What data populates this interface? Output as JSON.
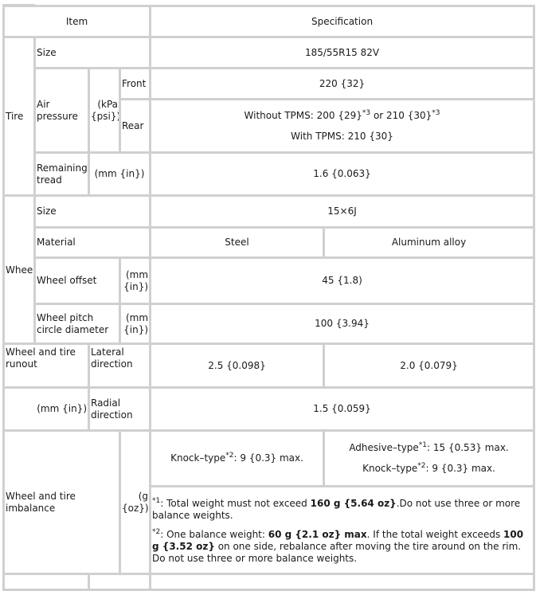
{
  "header": {
    "item": "Item",
    "specification": "Specification"
  },
  "tire": {
    "label": "Tire",
    "size": {
      "label": "Size",
      "value": "185/55R15 82V"
    },
    "air_pressure": {
      "label": "Air pressure",
      "unit": "(kPa {psi})",
      "front": {
        "label": "Front",
        "value": "220 {32}"
      },
      "rear": {
        "label": "Rear",
        "without_tpms_prefix": "Without TPMS: 200 {29}",
        "without_tpms_sup1": "*3",
        "without_tpms_mid": " or 210 {30}",
        "without_tpms_sup2": "*3",
        "with_tpms": "With TPMS: 210 {30}"
      }
    },
    "remaining_tread": {
      "label": "Remaining tread",
      "unit": "(mm {in})",
      "value": "1.6 {0.063}"
    }
  },
  "wheel": {
    "label": "Wheel",
    "size": {
      "label": "Size",
      "value": "15×6J"
    },
    "material": {
      "label": "Material",
      "steel": "Steel",
      "aluminum": "Aluminum alloy"
    },
    "offset": {
      "label": "Wheel offset",
      "unit": "(mm {in})",
      "value": "45 {1.8)"
    },
    "pitch_circle": {
      "label": "Wheel pitch circle diameter",
      "unit": "(mm {in})",
      "value": "100 {3.94}"
    }
  },
  "runout": {
    "label": "Wheel and tire runout",
    "unit": "(mm {in})",
    "lateral": {
      "label": "Lateral direction",
      "steel": "2.5 {0.098}",
      "aluminum": "2.0 {0.079}"
    },
    "radial": {
      "label": "Radial direction",
      "value": "1.5 {0.059}"
    }
  },
  "imbalance": {
    "label": "Wheel and tire imbalance",
    "unit": "(g {oz})",
    "steel": {
      "prefix": "Knock–type",
      "sup": "*2",
      "suffix": ": 9 {0.3} max."
    },
    "aluminum_adhesive": {
      "prefix": "Adhesive–type",
      "sup": "*1",
      "suffix": ": 15 {0.53} max."
    },
    "aluminum_knock": {
      "prefix": "Knock–type",
      "sup": "*2",
      "suffix": ": 9 {0.3} max."
    },
    "note1": {
      "sup": "*1",
      "text_a": ": Total weight must not exceed ",
      "bold_a": "160 g {5.64 oz}",
      "text_b": ".Do not use three or more balance weights."
    },
    "note2": {
      "sup": "*2",
      "text_a": ": One balance weight: ",
      "bold_a": "60 g {2.1 oz} max",
      "text_b": ". If the total weight exceeds ",
      "bold_b": "100 g {3.52 oz}",
      "text_c": " on one side, rebalance after moving the tire around on the rim. Do not use three or more balance weights."
    }
  }
}
